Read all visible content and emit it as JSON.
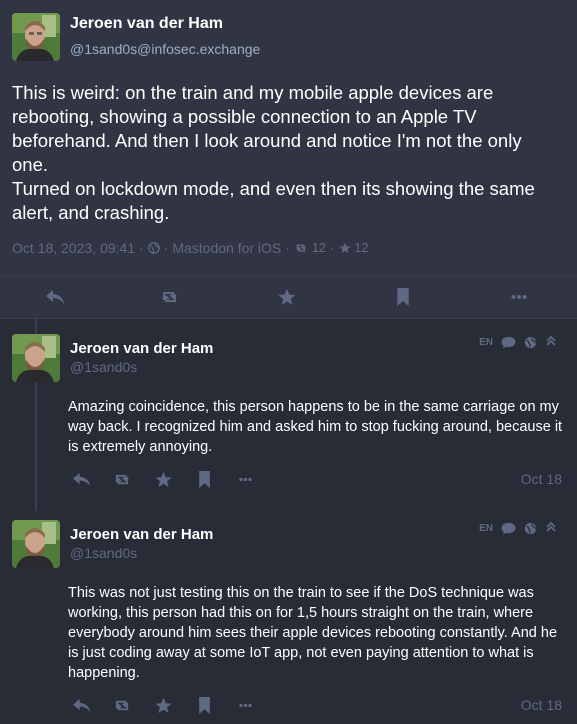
{
  "main_post": {
    "author_name": "Jeroen van der Ham",
    "author_handle": "@1sand0s@infosec.exchange",
    "paragraphs": [
      "This is weird: on the train and my mobile apple devices are rebooting, showing a possible connection to an Apple TV beforehand. And then I look around and notice I'm not the only one.",
      "Turned on lockdown mode, and even then its showing the same alert, and crashing."
    ],
    "timestamp": "Oct 18, 2023, 09:41",
    "separator": "·",
    "app": "Mastodon for iOS",
    "boosts": "12",
    "favourites": "12"
  },
  "replies": [
    {
      "author_name": "Jeroen van der Ham",
      "author_handle": "@1sand0s",
      "lang": "EN",
      "content": "Amazing coincidence, this person happens to be in the same carriage on my way back. I recognized him and asked him to stop fucking around, because it is extremely annoying.",
      "date": "Oct 18"
    },
    {
      "author_name": "Jeroen van der Ham",
      "author_handle": "@1sand0s",
      "lang": "EN",
      "content": "This was not just testing this on the train to see if the DoS technique was working, this person had this on for 1,5 hours straight on the train, where everybody around him sees their apple devices rebooting constantly. And he is just coding away at some IoT app, not even paying attention to what is happening.",
      "date": "Oct 18"
    }
  ],
  "icons": {
    "reply": "reply-icon",
    "boost": "boost-icon",
    "favourite": "star-icon",
    "bookmark": "bookmark-icon",
    "more": "ellipsis-icon",
    "visibility": "globe-icon",
    "chat": "comment-icon",
    "collapse": "double-chevron-up-icon"
  },
  "colors": {
    "background": "#282c37",
    "main_post_bg": "#313543",
    "text": "#ffffff",
    "secondary_text": "#9baec8",
    "muted_text": "#606984"
  }
}
